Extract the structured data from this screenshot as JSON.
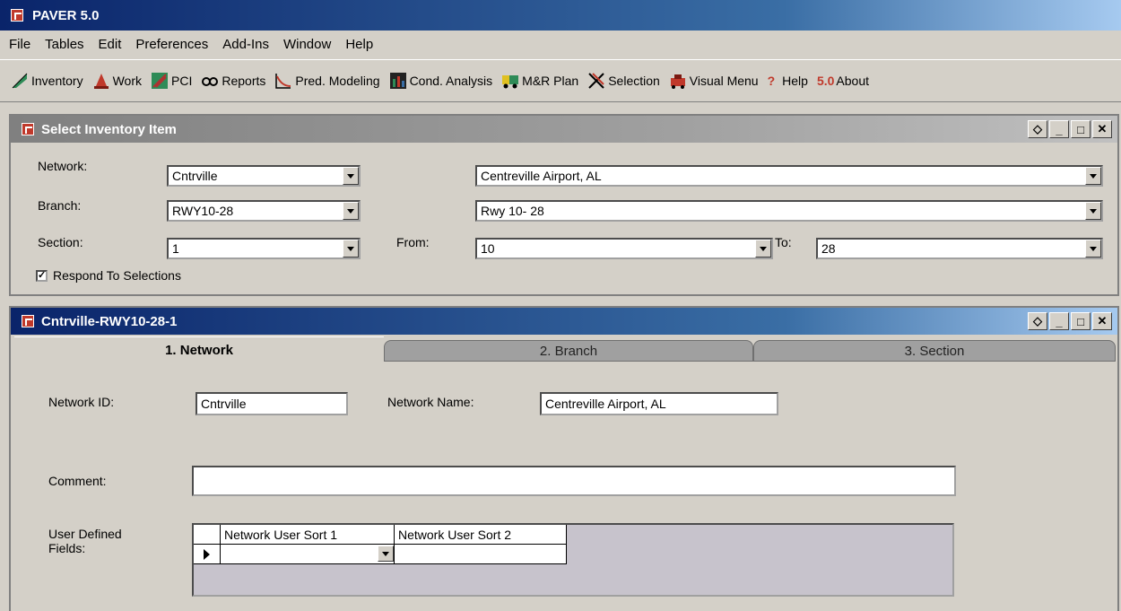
{
  "app": {
    "title": "PAVER 5.0"
  },
  "menu": [
    "File",
    "Tables",
    "Edit",
    "Preferences",
    "Add-Ins",
    "Window",
    "Help"
  ],
  "toolbar": {
    "inventory": "Inventory",
    "work": "Work",
    "pci": "PCI",
    "reports": "Reports",
    "pred_modeling": "Pred. Modeling",
    "cond_analysis": "Cond. Analysis",
    "mr_plan": "M&R Plan",
    "selection": "Selection",
    "visual_menu": "Visual Menu",
    "help": "Help",
    "about_version": "5.0",
    "about": "About"
  },
  "select_window": {
    "title": "Select Inventory Item",
    "network_label": "Network:",
    "network_value": "Cntrville",
    "network_name_value": "Centreville Airport, AL",
    "branch_label": "Branch:",
    "branch_value": "RWY10-28",
    "branch_name_value": "Rwy 10- 28",
    "section_label": "Section:",
    "section_value": "1",
    "from_label": "From:",
    "from_value": "10",
    "to_label": "To:",
    "to_value": "28",
    "respond_label": "Respond To Selections",
    "respond_checked": true
  },
  "detail_window": {
    "title": "Cntrville-RWY10-28-1",
    "tabs": [
      "1. Network",
      "2. Branch",
      "3. Section"
    ],
    "network_id_label": "Network ID:",
    "network_id_value": "Cntrville",
    "network_name_label": "Network Name:",
    "network_name_value": "Centreville Airport, AL",
    "comment_label": "Comment:",
    "comment_value": "",
    "udf_label_line1": "User Defined",
    "udf_label_line2": "Fields:",
    "grid_headers": [
      "Network User Sort 1",
      "Network User Sort 2"
    ]
  },
  "colors": {
    "titlebar": "#0a246a",
    "face": "#d4d0c8",
    "accent_red": "#c0392b"
  }
}
